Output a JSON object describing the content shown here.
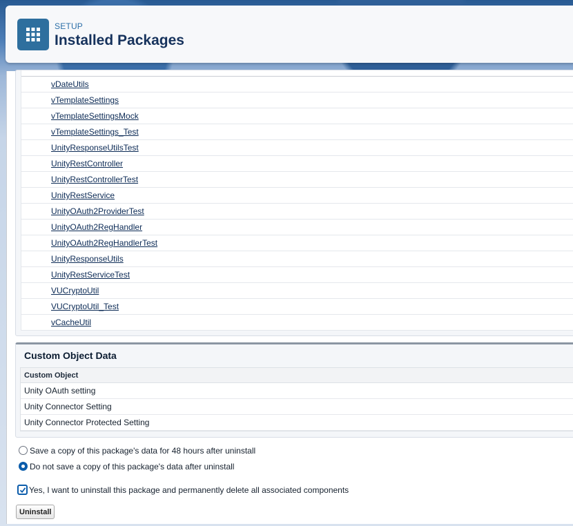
{
  "header": {
    "eyebrow": "SETUP",
    "title": "Installed Packages",
    "app_icon": "grid-icon"
  },
  "components": [
    "vDateUtils",
    "vTemplateSettings",
    "vTemplateSettingsMock",
    "vTemplateSettings_Test",
    "UnityResponseUtilsTest",
    "UnityRestController",
    "UnityRestControllerTest",
    "UnityRestService",
    "UnityOAuth2ProviderTest",
    "UnityOAuth2RegHandler",
    "UnityOAuth2RegHandlerTest",
    "UnityResponseUtils",
    "UnityRestServiceTest",
    "VUCryptoUtil",
    "VUCryptoUtil_Test",
    "vCacheUtil"
  ],
  "custom_object_data": {
    "title": "Custom Object Data",
    "column_header": "Custom Object",
    "rows": [
      "Unity OAuth setting",
      "Unity Connector Setting",
      "Unity Connector Protected Setting"
    ]
  },
  "options": {
    "save_copy_label": "Save a copy of this package's data for 48 hours after uninstall",
    "no_save_label": "Do not save a copy of this package's data after uninstall",
    "selected": "no_save"
  },
  "confirm": {
    "label": "Yes, I want to uninstall this package and permanently delete all associated components",
    "checked": true
  },
  "uninstall_button_label": "Uninstall",
  "colors": {
    "accent": "#0b5cab",
    "app_tile": "#2e6f9e",
    "title": "#16325c"
  }
}
